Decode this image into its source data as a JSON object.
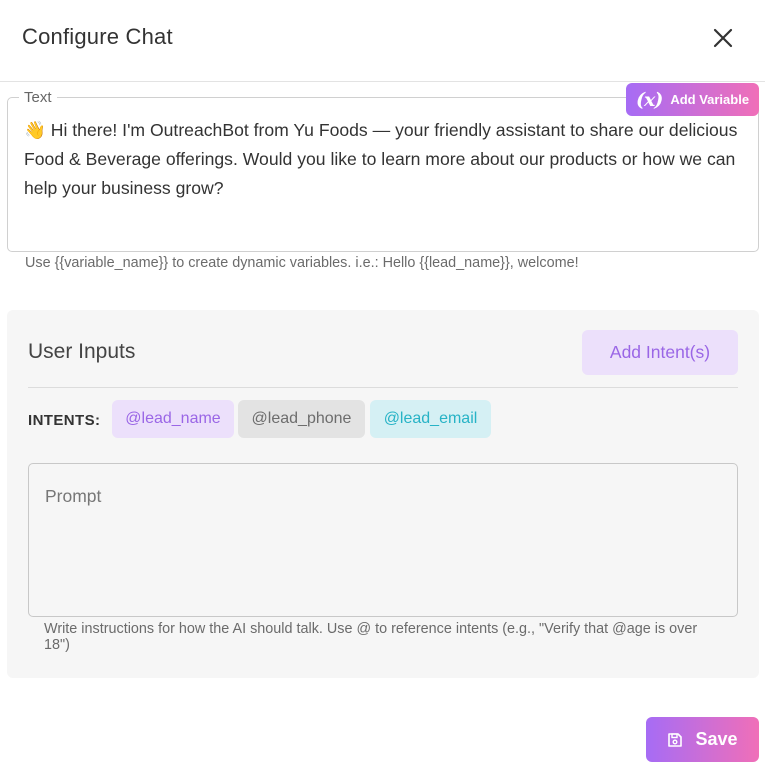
{
  "dialog": {
    "title": "Configure Chat"
  },
  "text_section": {
    "legend": "Text",
    "content": "👋 Hi there! I'm OutreachBot from Yu Foods — your friendly assistant to share our delicious Food & Beverage offerings. Would you like to learn more about our products or how we can help your business grow?",
    "helper": "Use {{variable_name}} to create dynamic variables. i.e.: Hello {{lead_name}}, welcome!",
    "add_variable": {
      "icon_text": "(x)",
      "label": "Add Variable"
    }
  },
  "user_inputs": {
    "title": "User Inputs",
    "add_intent_label": "Add Intent(s)",
    "intents_label": "INTENTS:",
    "intents": [
      {
        "label": "@lead_name",
        "color": "#9a66e6"
      },
      {
        "label": "@lead_phone",
        "color": "#6d6d6d"
      },
      {
        "label": "@lead_email",
        "color": "#27b3c6"
      }
    ],
    "prompt": {
      "placeholder": "Prompt",
      "value": ""
    },
    "prompt_helper": "Write instructions for how the AI should talk. Use @ to reference intents (e.g., \"Verify that @age is over 18\")"
  },
  "footer": {
    "save_label": "Save"
  },
  "colors": {
    "accent_start": "#a66cf5",
    "accent_end": "#f06fb8"
  }
}
